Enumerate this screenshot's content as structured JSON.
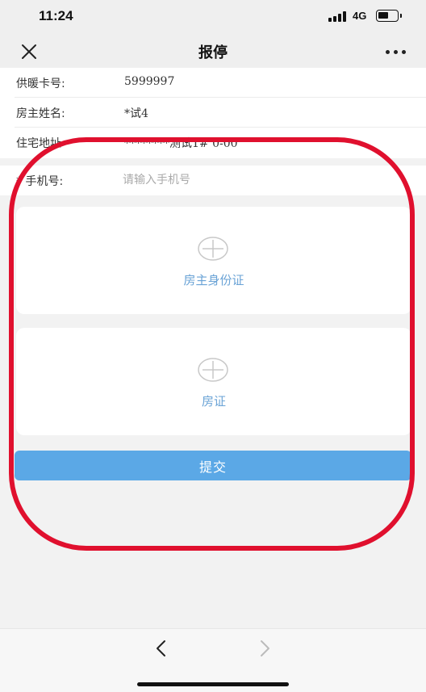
{
  "status_bar": {
    "time": "11:24",
    "network": "4G"
  },
  "nav": {
    "title": "报停",
    "close_icon": "close-icon",
    "more_icon": "more-icon"
  },
  "info": {
    "rows": [
      {
        "label": "供暖卡号:",
        "value": "5999997"
      },
      {
        "label": "房主姓名:",
        "value": "*试4"
      },
      {
        "label": "住宅地址",
        "value": "********测试1# 0-00"
      }
    ]
  },
  "phone": {
    "label": "* 手机号:",
    "placeholder": "请输入手机号"
  },
  "uploads": [
    {
      "label": "房主身份证",
      "icon": "plus-circle-icon"
    },
    {
      "label": "房证",
      "icon": "plus-circle-icon"
    }
  ],
  "submit": {
    "label": "提交"
  },
  "colors": {
    "accent": "#5ba8e6",
    "upload_label": "#6aa3d6",
    "annotation": "#e0102e",
    "background": "#f2f2f2"
  }
}
